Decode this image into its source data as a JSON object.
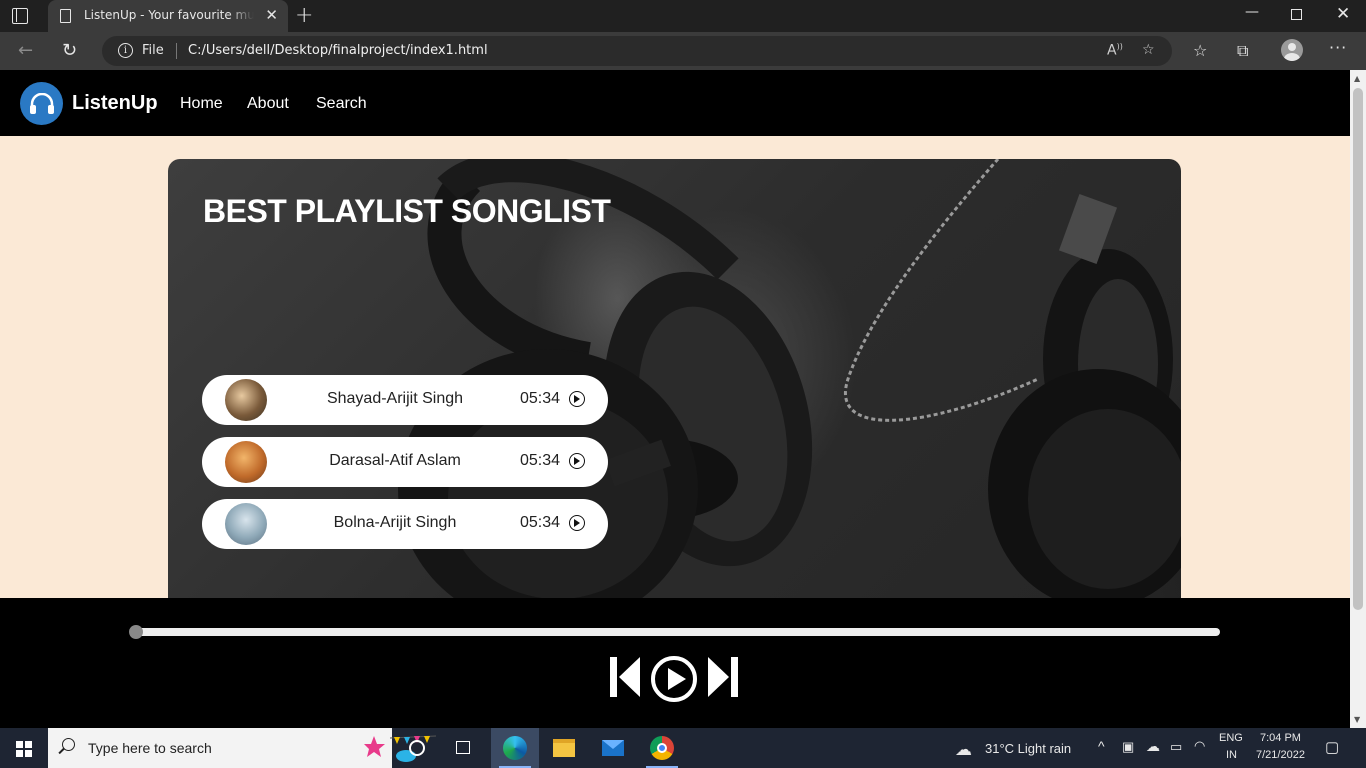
{
  "browser": {
    "tab_title": "ListenUp - Your favourite music is here",
    "tab_close": "✕",
    "new_tab": "+",
    "address_file_label": "File",
    "address_url": "C:/Users/dell/Desktop/finalproject/index1.html",
    "window_controls": {
      "minimize": "—",
      "close": "✕"
    }
  },
  "navbar": {
    "brand": "ListenUp",
    "links": [
      "Home",
      "About",
      "Search"
    ]
  },
  "hero": {
    "title": "BEST PLAYLIST SONGLIST",
    "songs": [
      {
        "name": "Shayad-Arijit Singh",
        "duration": "05:34"
      },
      {
        "name": "Darasal-Atif Aslam",
        "duration": "05:34"
      },
      {
        "name": "Bolna-Arijit Singh",
        "duration": "05:34"
      }
    ]
  },
  "player": {
    "progress": 0,
    "controls": [
      "previous",
      "play",
      "next"
    ]
  },
  "taskbar": {
    "search_placeholder": "Type here to search",
    "weather": "31°C  Light rain",
    "lang_top": "ENG",
    "lang_bottom": "IN",
    "time": "7:04 PM",
    "date": "7/21/2022"
  },
  "colors": {
    "page_bg": "#fbe9d6",
    "navbar_bg": "#000000",
    "logo_blue": "#2a79c4",
    "player_bg": "#000000"
  }
}
